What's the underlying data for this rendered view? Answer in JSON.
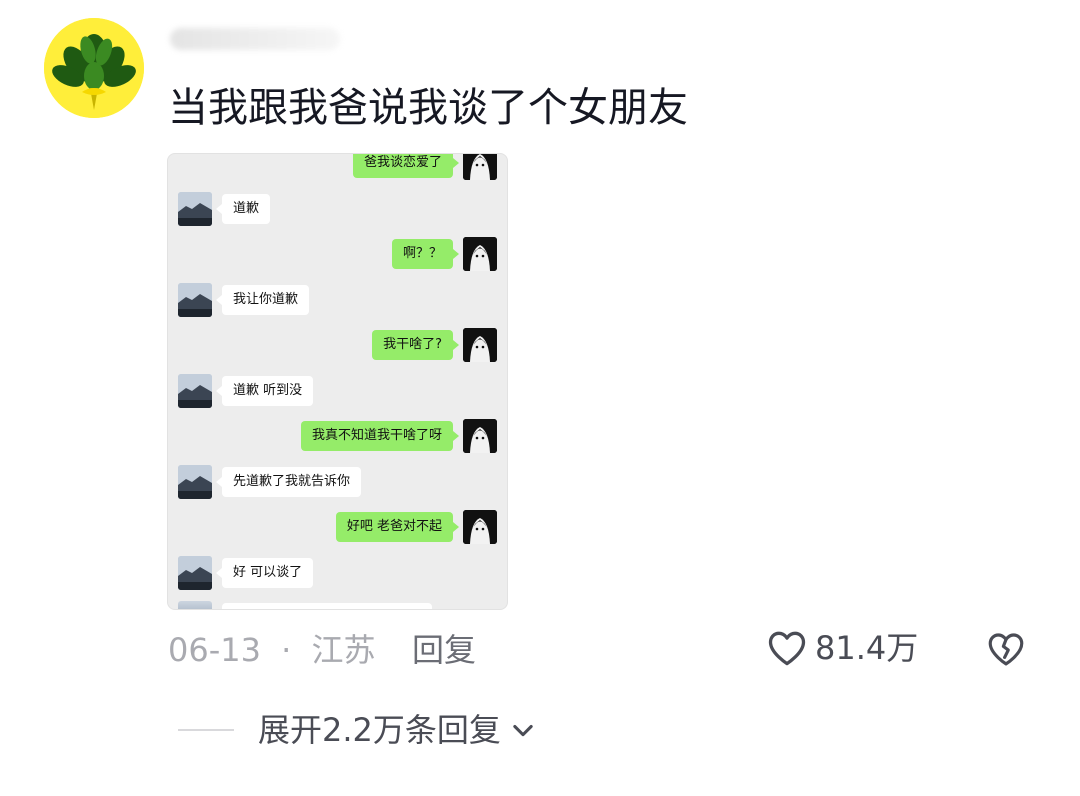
{
  "comment": {
    "text": "当我跟我爸说我谈了个女朋友",
    "date": "06-13",
    "separator": "·",
    "location": "江苏",
    "reply_label": "回复",
    "like_count": "81.4万",
    "expand_label": "展开2.2万条回复"
  },
  "screenshot": {
    "messages": [
      {
        "side": "right",
        "text": "爸我谈恋爱了"
      },
      {
        "side": "left",
        "text": "道歉"
      },
      {
        "side": "right",
        "text": "啊？？"
      },
      {
        "side": "left",
        "text": "我让你道歉"
      },
      {
        "side": "right",
        "text": "我干啥了?"
      },
      {
        "side": "left",
        "text": "道歉 听到没"
      },
      {
        "side": "right",
        "text": "我真不知道我干啥了呀"
      },
      {
        "side": "left",
        "text": "先道歉了我就告诉你"
      },
      {
        "side": "right",
        "text": "好吧 老爸对不起"
      },
      {
        "side": "left",
        "text": "好 可以谈了"
      }
    ]
  },
  "icons": {
    "avatar": "plant-avatar",
    "like": "heart-outline-icon",
    "dislike": "broken-heart-icon",
    "expand": "chevron-down-icon"
  },
  "colors": {
    "bubble_green": "#95ec69",
    "chat_bg": "#ededed",
    "meta_gray": "#a9aab0"
  }
}
